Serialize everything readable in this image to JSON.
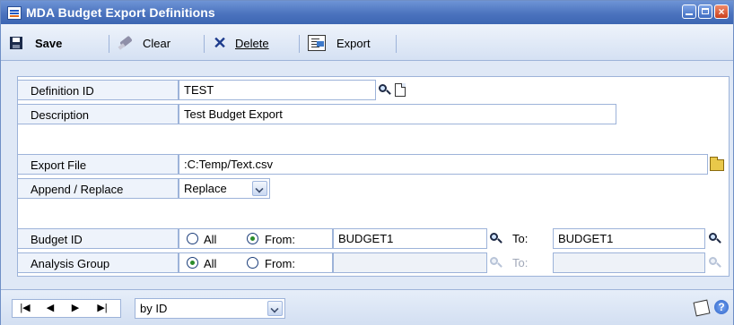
{
  "window": {
    "title": "MDA Budget Export Definitions"
  },
  "toolbar": {
    "save": "Save",
    "clear": "Clear",
    "delete": "Delete",
    "export": "Export"
  },
  "form": {
    "definition_id": {
      "label": "Definition ID",
      "value": "TEST"
    },
    "description": {
      "label": "Description",
      "value": "Test Budget Export"
    },
    "export_file": {
      "label": "Export File",
      "value": ":C:Temp/Text.csv"
    },
    "append_replace": {
      "label": "Append / Replace",
      "value": "Replace"
    },
    "budget_id": {
      "label": "Budget ID",
      "opt_all": "All",
      "opt_from": "From:",
      "selected": "From:",
      "from": "BUDGET1",
      "to_label": "To:",
      "to": "BUDGET1"
    },
    "analysis_group": {
      "label": "Analysis Group",
      "opt_all": "All",
      "opt_from": "From:",
      "selected": "All",
      "from": "",
      "to_label": "To:",
      "to": ""
    }
  },
  "statusbar": {
    "nav": {
      "first": "|◀",
      "prev": "◀",
      "next": "▶",
      "last": "▶|"
    },
    "sort": "by ID"
  },
  "colors": {
    "titlebar": "#4b73be",
    "window_bg": "#dfe8f6",
    "border": "#9db3d9",
    "radio_on": "#2b8c2b"
  },
  "icons": [
    "app-icon",
    "minimize-icon",
    "maximize-icon",
    "close-icon",
    "save-icon",
    "clear-icon",
    "delete-icon",
    "export-icon",
    "lookup-icon",
    "new-icon",
    "folder-icon",
    "note-icon",
    "help-icon"
  ]
}
